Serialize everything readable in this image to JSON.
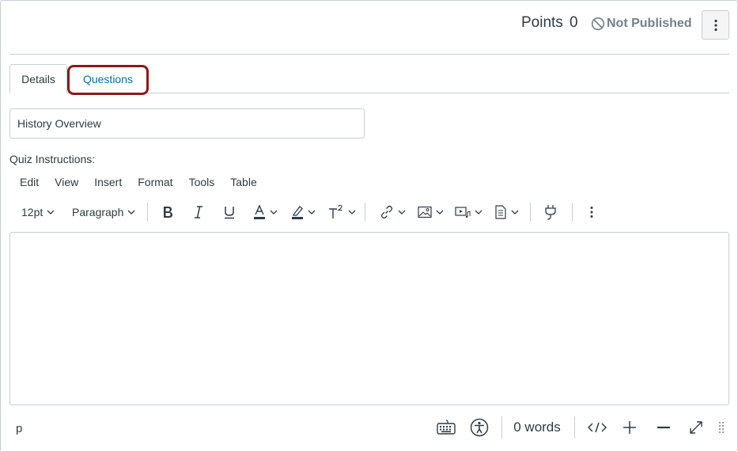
{
  "header": {
    "points_label": "Points",
    "points_value": "0",
    "publish_status": "Not Published",
    "publish_icon": "not-published-icon",
    "options_icon": "kebab-vertical-icon"
  },
  "tabs": [
    {
      "label": "Details",
      "active": true
    },
    {
      "label": "Questions",
      "active": false,
      "highlighted": true
    }
  ],
  "quiz_title": {
    "value": "History Overview"
  },
  "instructions": {
    "label": "Quiz Instructions:",
    "menubar": [
      "Edit",
      "View",
      "Insert",
      "Format",
      "Tools",
      "Table"
    ],
    "toolbar": {
      "font_size": "12pt",
      "block_format": "Paragraph",
      "buttons": [
        "bold-icon",
        "italic-icon",
        "underline-icon",
        "text-color-icon",
        "highlight-color-icon",
        "superscript-icon",
        "link-icon",
        "image-icon",
        "media-icon",
        "document-icon",
        "plugin-icon",
        "more-icon"
      ]
    },
    "statusbar": {
      "path": "p",
      "word_count": "0 words",
      "icons": [
        "keyboard-icon",
        "accessibility-icon",
        "html-editor-icon",
        "zoom-in-icon",
        "zoom-out-icon",
        "fullscreen-icon",
        "resize-handle-icon"
      ]
    }
  },
  "colors": {
    "link": "#0770a3",
    "text": "#2d3b45",
    "muted": "#73818c",
    "border": "#c7cdd1",
    "highlight": "#8b1a1a"
  }
}
